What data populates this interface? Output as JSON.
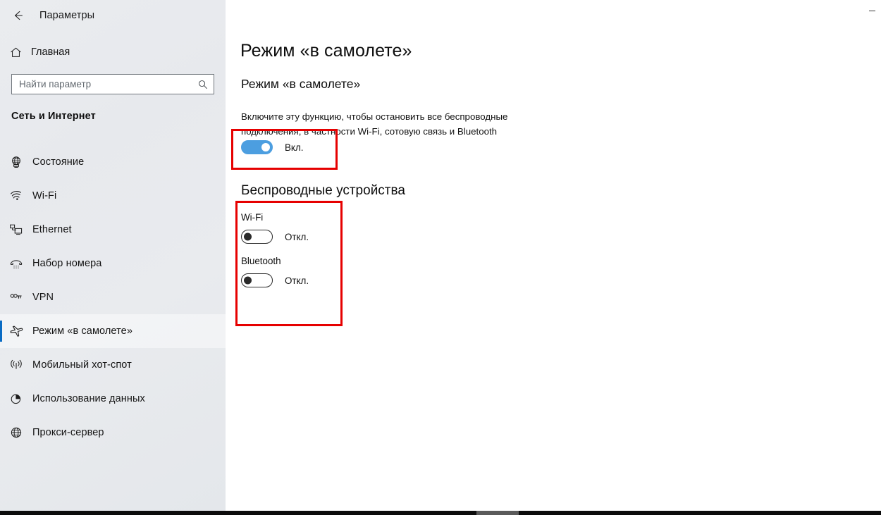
{
  "window": {
    "app_title": "Параметры",
    "back_icon": "back-arrow-icon",
    "minimize_icon": "minimize-icon"
  },
  "sidebar": {
    "home": {
      "label": "Главная",
      "icon": "home-icon"
    },
    "search": {
      "placeholder": "Найти параметр",
      "value": "",
      "icon": "search-icon"
    },
    "section_title": "Сеть и Интернет",
    "items": [
      {
        "label": "Состояние",
        "icon": "status-globe-icon",
        "selected": false
      },
      {
        "label": "Wi-Fi",
        "icon": "wifi-icon",
        "selected": false
      },
      {
        "label": "Ethernet",
        "icon": "ethernet-icon",
        "selected": false
      },
      {
        "label": "Набор номера",
        "icon": "dialup-phone-icon",
        "selected": false
      },
      {
        "label": "VPN",
        "icon": "vpn-icon",
        "selected": false
      },
      {
        "label": "Режим «в самолете»",
        "icon": "airplane-icon",
        "selected": true
      },
      {
        "label": "Мобильный хот-спот",
        "icon": "hotspot-icon",
        "selected": false
      },
      {
        "label": "Использование данных",
        "icon": "data-usage-pie-icon",
        "selected": false
      },
      {
        "label": "Прокси-сервер",
        "icon": "proxy-globe-icon",
        "selected": false
      }
    ]
  },
  "main": {
    "page_title": "Режим «в самолете»",
    "airplane_section": {
      "heading": "Режим «в самолете»",
      "description": "Включите эту функцию, чтобы остановить все беспроводные подключения, в частности Wi-Fi, сотовую связь и Bluetooth",
      "toggle_state_label": "Вкл.",
      "toggle_on": true
    },
    "wireless_section": {
      "heading": "Беспроводные устройства",
      "devices": [
        {
          "label": "Wi-Fi",
          "state_label": "Откл.",
          "on": false
        },
        {
          "label": "Bluetooth",
          "state_label": "Откл.",
          "on": false
        }
      ]
    }
  },
  "annotations": {
    "accent_color": "#e60000",
    "boxes": [
      {
        "name": "airplane-mode-toggle-highlight"
      },
      {
        "name": "wireless-devices-highlight"
      }
    ]
  },
  "colors": {
    "toggle_on": "#4c9ee0",
    "selection_accent": "#0a6cc4",
    "sidebar_bg": "#e8eaee",
    "content_bg": "#ffffff"
  }
}
